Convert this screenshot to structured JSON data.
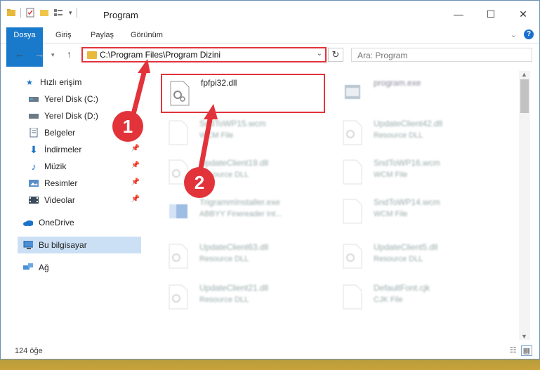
{
  "window": {
    "title": "Program",
    "controls": {
      "minimize": "—",
      "maximize": "☐",
      "close": "✕"
    }
  },
  "ribbon": {
    "tabs": [
      "Dosya",
      "Giriş",
      "Paylaş",
      "Görünüm"
    ],
    "help": "?"
  },
  "address": {
    "path": "C:\\Program Files\\Program Dizini",
    "search_placeholder": "Ara: Program"
  },
  "sidebar": {
    "quick_access": "Hızlı erişim",
    "items": [
      {
        "label": "Yerel Disk (C:)",
        "icon": "drive-icon"
      },
      {
        "label": "Yerel Disk (D:)",
        "icon": "drive-icon"
      },
      {
        "label": "Belgeler",
        "icon": "documents-icon"
      },
      {
        "label": "İndirmeler",
        "icon": "download-icon",
        "pinned": true
      },
      {
        "label": "Müzik",
        "icon": "music-icon",
        "pinned": true
      },
      {
        "label": "Resimler",
        "icon": "pictures-icon",
        "pinned": true
      },
      {
        "label": "Videolar",
        "icon": "videos-icon",
        "pinned": true
      }
    ],
    "onedrive": "OneDrive",
    "this_pc": "Bu bilgisayar",
    "network": "Ağ"
  },
  "files": [
    {
      "name": "fpfpi32.dll",
      "type": ""
    },
    {
      "name": "program.exe",
      "type": ""
    },
    {
      "name": "SndToWP15.wcm",
      "type": "WCM File"
    },
    {
      "name": "UpdateClient42.dll",
      "type": "Resource DLL"
    },
    {
      "name": "UpdateClient19.dll",
      "type": "Resource DLL"
    },
    {
      "name": "SndToWP16.wcm",
      "type": "WCM File"
    },
    {
      "name": "TrigrammInstaller.exe",
      "type": "ABBYY Finereader Int..."
    },
    {
      "name": "SndToWP14.wcm",
      "type": "WCM File"
    },
    {
      "name": "UpdateClient63.dll",
      "type": "Resource DLL"
    },
    {
      "name": "UpdateClient5.dll",
      "type": "Resource DLL"
    },
    {
      "name": "UpdateClient21.dll",
      "type": "Resource DLL"
    },
    {
      "name": "DefaultFont.cjk",
      "type": "CJK File"
    }
  ],
  "status": {
    "count": "124 öğe"
  },
  "annotations": {
    "step1": "1",
    "step2": "2"
  },
  "colors": {
    "accent": "#1979ca",
    "highlight": "#e2333b",
    "selected": "#cce0f5"
  }
}
